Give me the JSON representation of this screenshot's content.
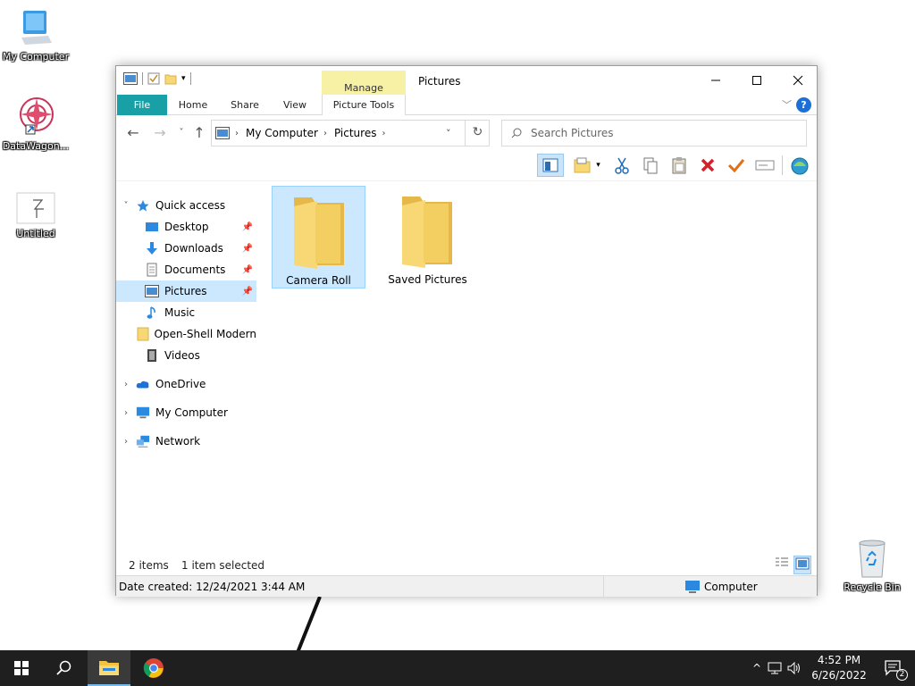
{
  "desktop": {
    "icons": [
      {
        "label": "My Computer"
      },
      {
        "label": "DataWagon..."
      },
      {
        "label": "Untitled"
      },
      {
        "label": "Recycle Bin"
      }
    ]
  },
  "window": {
    "title": "Pictures",
    "contextual_tab_group": "Manage",
    "ribbon_tabs": [
      "File",
      "Home",
      "Share",
      "View",
      "Picture Tools"
    ],
    "help_label": "?",
    "nav": {
      "breadcrumb": [
        "My Computer",
        "Pictures"
      ],
      "search_placeholder": "Search Pictures"
    },
    "toolbar_icons": [
      "preview-pane-icon",
      "new-folder-icon",
      "cut-icon",
      "copy-icon",
      "paste-icon",
      "delete-icon",
      "check-icon",
      "rename-icon",
      "properties-icon"
    ],
    "navpane": {
      "quick_access": "Quick access",
      "quick_items": [
        "Desktop",
        "Downloads",
        "Documents",
        "Pictures",
        "Music",
        "Open-Shell Modern",
        "Videos"
      ],
      "onedrive": "OneDrive",
      "my_computer": "My Computer",
      "network": "Network"
    },
    "files": [
      {
        "name": "Camera Roll",
        "selected": true
      },
      {
        "name": "Saved Pictures",
        "selected": false
      }
    ],
    "status": {
      "count": "2 items",
      "selection": "1 item selected"
    },
    "details": {
      "date_created": "Date created: 12/24/2021 3:44 AM",
      "location": "Computer"
    }
  },
  "taskbar": {
    "time": "4:52 PM",
    "date": "6/26/2022",
    "notification_count": "2"
  },
  "colors": {
    "file_tab": "#19a0a7",
    "manage_tab": "#f7f1a5",
    "selection": "#cce8ff",
    "taskbar": "#1f1f1f"
  }
}
